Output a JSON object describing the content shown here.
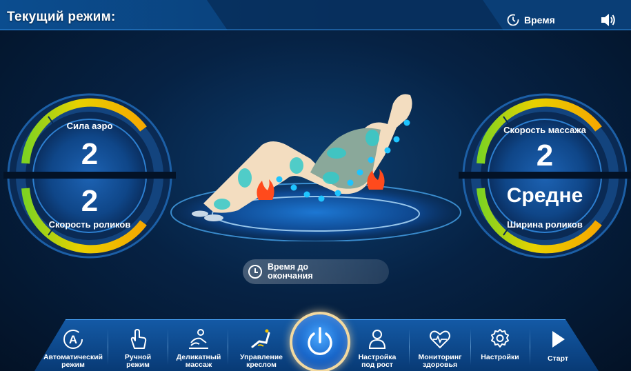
{
  "header": {
    "title": "Текущий режим:",
    "time_label": "Время"
  },
  "left_gauge": {
    "top_label": "Сила аэро",
    "top_value": "2",
    "bottom_value": "2",
    "bottom_label": "Скорость роликов"
  },
  "right_gauge": {
    "top_label": "Скорость массажа",
    "top_value": "2",
    "bottom_value": "Средне",
    "bottom_label": "Ширина роликов"
  },
  "remaining": {
    "line1": "Время до",
    "line2": "окончания"
  },
  "nav": {
    "items": [
      {
        "l1": "Автоматический",
        "l2": "режим",
        "icon": "auto-mode-icon"
      },
      {
        "l1": "Ручной",
        "l2": "режим",
        "icon": "hand-icon"
      },
      {
        "l1": "Деликатный",
        "l2": "массаж",
        "icon": "massage-icon"
      },
      {
        "l1": "Управление",
        "l2": "креслом",
        "icon": "chair-control-icon"
      },
      {
        "l1": "Настройка",
        "l2": "под рост",
        "icon": "person-icon"
      },
      {
        "l1": "Мониторинг",
        "l2": "здоровья",
        "icon": "heart-icon"
      },
      {
        "l1": "Настройки",
        "l2": "",
        "icon": "gear-icon"
      },
      {
        "l1": "Старт",
        "l2": "",
        "icon": "play-icon"
      }
    ]
  },
  "colors": {
    "accent": "#1f8fff",
    "gauge_yellow": "#f5c400",
    "gauge_green": "#7ed321",
    "gauge_orange": "#f08c00",
    "power_ring": "#f2d9a0"
  }
}
